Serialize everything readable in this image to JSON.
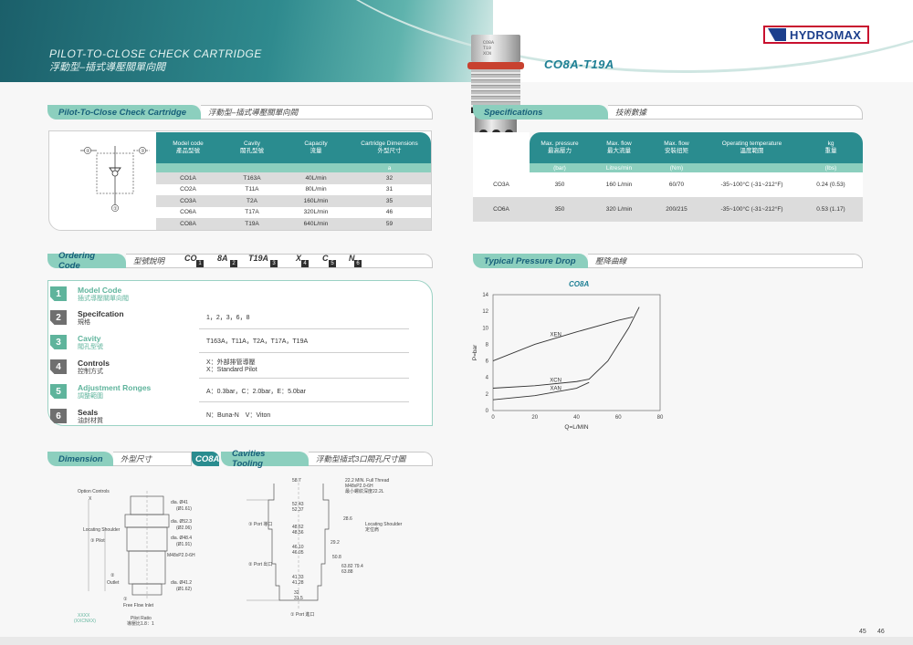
{
  "header": {
    "title_en": "PILOT-TO-CLOSE CHECK CARTRIDGE",
    "title_cn": "浮動型–插式導壓關單向閥",
    "model": "CO8A-T19A",
    "logo": "HYDROMAX",
    "cartridge_marking": [
      "CO8A",
      "T19",
      "XCN"
    ]
  },
  "colors": {
    "teal": "#2a8c8f",
    "mint": "#8ccfbe",
    "brand_red": "#c8102e",
    "brand_blue": "#1c3f8c"
  },
  "section_pilot": {
    "title": "Pilot-To-Close Check Cartridge",
    "sub": "浮動型–插式導壓關單向閥"
  },
  "section_spec": {
    "title": "Specifications",
    "sub": "技術數據"
  },
  "section_order": {
    "title": "Ordering Code",
    "sub": "型號說明"
  },
  "section_pressure": {
    "title": "Typical Pressure Drop",
    "sub": "壓降曲線"
  },
  "section_dimension": {
    "title": "Dimension",
    "sub": "外型尺寸",
    "tag": "CO8A"
  },
  "section_cavities": {
    "title": "Cavities Tooling",
    "sub": "浮動型插式3口閥孔尺寸圖"
  },
  "symbol": {
    "port1": "①",
    "port2": "②",
    "port3": "③"
  },
  "model_table": {
    "headers": [
      {
        "en": "Model code",
        "cn": "產品型號"
      },
      {
        "en": "Cavity",
        "cn": "閥孔型號"
      },
      {
        "en": "Capacity",
        "cn": "流量"
      },
      {
        "en": "Cartridge Dimensions",
        "cn": "外型尺寸"
      }
    ],
    "units": [
      "",
      "",
      "",
      "a"
    ],
    "rows": [
      [
        "CO1A",
        "T163A",
        "40L/min",
        "32"
      ],
      [
        "CO2A",
        "T11A",
        "80L/min",
        "31"
      ],
      [
        "CO3A",
        "T2A",
        "160L/min",
        "35"
      ],
      [
        "CO6A",
        "T17A",
        "320L/min",
        "46"
      ],
      [
        "CO8A",
        "T19A",
        "640L/min",
        "59"
      ]
    ]
  },
  "spec_table": {
    "headers": [
      {
        "en": "",
        "cn": ""
      },
      {
        "en": "Max. pressure",
        "cn": "最高壓力"
      },
      {
        "en": "Max. flow",
        "cn": "最大流量"
      },
      {
        "en": "Max. flow",
        "cn": "安裝扭矩"
      },
      {
        "en": "Operating temperature",
        "cn": "溫度範圍"
      },
      {
        "en": "kg",
        "cn": "重量"
      }
    ],
    "units": [
      "",
      "(bar)",
      "Litres/min",
      "(Nm)",
      "",
      "(lbs)"
    ],
    "rows": [
      [
        "CO3A",
        "350",
        "160 L/min",
        "60/70",
        "-35~100°C (-31~212°F)",
        "0.24 (0.53)"
      ],
      [
        "CO6A",
        "350",
        "320 L/min",
        "200/215",
        "-35~100°C (-31~212°F)",
        "0.53 (1.17)"
      ]
    ]
  },
  "ordering_code": {
    "label": "型號說明",
    "chars": [
      "CO",
      "8A",
      "T19A",
      "X",
      "C",
      "N"
    ],
    "indices": [
      "1",
      "2",
      "3",
      "4",
      "5",
      "6"
    ],
    "items": [
      {
        "num": "1",
        "en": "Model Code",
        "cn": "插式導壓關單向閥",
        "value": "",
        "highlight": true
      },
      {
        "num": "2",
        "en": "Specifcation",
        "cn": "規格",
        "value": "1，2，3，6，8",
        "highlight": false
      },
      {
        "num": "3",
        "en": "Cavity",
        "cn": "閥孔型號",
        "value": "T163A，T11A，T2A，T17A，T19A",
        "highlight": true
      },
      {
        "num": "4",
        "en": "Controls",
        "cn": "控制方式",
        "value": "X：外部排管導壓",
        "value2": "X：Standard Pilot",
        "highlight": false
      },
      {
        "num": "5",
        "en": "Adjustment Ronges",
        "cn": "調整範圍",
        "value": "A：0.3bar，C：2.0bar，E：5.0bar",
        "highlight": true
      },
      {
        "num": "6",
        "en": "Seals",
        "cn": "油封材質",
        "value": "N：Buna-N　V：Viton",
        "highlight": false
      }
    ]
  },
  "chart_data": {
    "type": "line",
    "title": "CO8A",
    "xlabel": "Q=L/MIN",
    "ylabel": "P=bar",
    "xlim": [
      0,
      80
    ],
    "ylim": [
      0,
      14
    ],
    "xticks": [
      "0",
      "20",
      "40",
      "60",
      "80"
    ],
    "yticks": [
      "0",
      "2",
      "4",
      "6",
      "8",
      "10",
      "12",
      "14"
    ],
    "grid": false,
    "series": [
      {
        "name": "XEN",
        "x": [
          0,
          20,
          40,
          60,
          67
        ],
        "y": [
          6.0,
          8.0,
          9.5,
          10.9,
          11.3
        ]
      },
      {
        "name": "XCN",
        "x": [
          0,
          20,
          40,
          46,
          55,
          65,
          70
        ],
        "y": [
          2.7,
          3.0,
          3.5,
          3.8,
          6.0,
          10.0,
          12.5
        ]
      },
      {
        "name": "XAN",
        "x": [
          0,
          20,
          40,
          46
        ],
        "y": [
          1.3,
          1.8,
          2.7,
          3.4
        ]
      }
    ]
  },
  "dimension": {
    "labels": [
      "Option Controls",
      "X",
      "Locating Shoulder",
      "定位肩",
      "③ Pilot",
      "導控口",
      "②",
      "Outlet",
      "出油口",
      "①",
      "Free Flow Inlet",
      "單向口",
      "Pilot Ratio",
      "導壓比1.8：1",
      "dia. Ø41",
      "(Ø1.61)",
      "dia. Ø52.3",
      "(Ø2.06)",
      "dia. Ø48.4",
      "(Ø1.91)",
      "M48xP2.0-6H",
      "dia. Ø41.2",
      "(Ø1.62)",
      "Ø3.5",
      "33.5",
      "10",
      "XXXX",
      "(XXCNXX)"
    ],
    "tooling": [
      "58.7",
      "52.43",
      "52.37",
      "48.62",
      "48.56",
      "46.10",
      "46.05",
      "41.33",
      "41.28",
      "32",
      "31.5",
      "22.2 MIN. Full Thread",
      "M48xP2.0-6H",
      "最小螺紋深度22.2L",
      "③ Port 導口",
      "② Port 出口",
      "① Port 進口",
      "Locating Shoulder",
      "定位肩",
      "28.6",
      "29.2",
      "50.8",
      "63.82",
      "63.88",
      "79.4",
      "1.6",
      "7.5",
      "1.6 / 0.8",
      "15.4 / 5.0",
      "20.1 / 5.0"
    ]
  },
  "page_numbers": [
    "45",
    "46"
  ]
}
